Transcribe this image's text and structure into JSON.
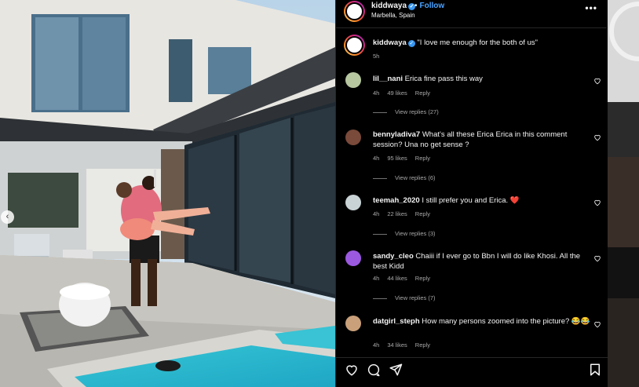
{
  "header": {
    "username": "kiddwaya",
    "separator": "•",
    "follow_label": "Follow",
    "location": "Marbella, Spain",
    "more_label": "•••"
  },
  "caption": {
    "username": "kiddwaya",
    "text": "\"I love me enough for the both of us\"",
    "time": "5h"
  },
  "comments": [
    {
      "username": "lil__nani",
      "text": "Erica fine pass this way",
      "time": "4h",
      "likes": "49 likes",
      "reply": "Reply",
      "view_replies": "View replies (27)",
      "avatar_color": "#b7c7a0"
    },
    {
      "username": "bennyladiva7",
      "text": "What's all these Erica Erica in this comment session? Una no get sense ?",
      "time": "4h",
      "likes": "95 likes",
      "reply": "Reply",
      "view_replies": "View replies (6)",
      "avatar_color": "#7a4a3a"
    },
    {
      "username": "teemah_2020",
      "text": "I still prefer you and Erica. ❤️",
      "time": "4h",
      "likes": "22 likes",
      "reply": "Reply",
      "view_replies": "View replies (3)",
      "avatar_color": "#c9d3d6"
    },
    {
      "username": "sandy_cleo",
      "text": "Chaiii if I ever go to Bbn I will do like Khosi. All the best Kidd",
      "time": "4h",
      "likes": "44 likes",
      "reply": "Reply",
      "view_replies": "View replies (7)",
      "avatar_color": "#9b59e0"
    },
    {
      "username": "datgirl_steph",
      "text": "How many persons zoomed into the picture? 😂😂",
      "time": "4h",
      "likes": "34 likes",
      "reply": "Reply",
      "view_replies": "",
      "avatar_color": "#c9a07a"
    }
  ],
  "icons": {
    "like": "heart-icon",
    "comment": "comment-icon",
    "share": "share-icon",
    "save": "bookmark-icon",
    "prev": "chevron-left-icon"
  },
  "prev_glyph": "‹",
  "colors": {
    "follow": "#4aa3ff",
    "verified": "#3897f0",
    "background": "#000000"
  }
}
